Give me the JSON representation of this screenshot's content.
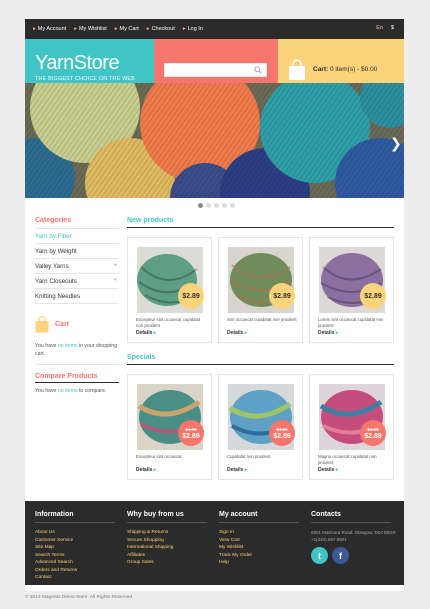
{
  "topbar": {
    "links": [
      "My Account",
      "My Wishlist",
      "My Cart",
      "Checkout",
      "Log In"
    ],
    "lang": "En",
    "currency": "$"
  },
  "logo": {
    "name": "YarnStore",
    "tagline": "THE BIGGEST CHOICE ON THE WEB"
  },
  "search": {
    "placeholder": ""
  },
  "cart": {
    "label": "Cart:",
    "summary": "0 item(s) - $0.00"
  },
  "banner": {
    "arrow": "❯"
  },
  "sidebar": {
    "categories_title": "Categories",
    "categories": [
      {
        "label": "Yarn by Fiber",
        "selected": true,
        "plus": false
      },
      {
        "label": "Yarn by Weight",
        "selected": false,
        "plus": false
      },
      {
        "label": "Valley Yarns",
        "selected": false,
        "plus": true
      },
      {
        "label": "Yarn Closeouts",
        "selected": false,
        "plus": true
      },
      {
        "label": "Knitting Needles",
        "selected": false,
        "plus": false
      }
    ],
    "cart_title": "Cart",
    "cart_text_1": "You have ",
    "cart_text_link": "no items",
    "cart_text_2": " in your shopping cart.",
    "compare_title": "Compare Products",
    "compare_text_1": "You have ",
    "compare_text_link": "no items",
    "compare_text_2": " to compare."
  },
  "new_products": {
    "title": "New products",
    "items": [
      {
        "price": "$2.89",
        "desc": "Excepteur sint occaecat cupidatat non proident",
        "details": "Details",
        "color": "#5e9e84"
      },
      {
        "price": "$2.89",
        "desc": "Sint occaecat cupidatat non proident",
        "details": "Details",
        "color": "#6f8c5a"
      },
      {
        "price": "$2.89",
        "desc": "Lorem sint occaecat cupidatat non proident",
        "details": "Details",
        "color": "#8a6fa0"
      }
    ]
  },
  "specials": {
    "title": "Specials",
    "items": [
      {
        "old": "$4.89",
        "price": "$2.89",
        "desc": "Excepteur sint occaecat",
        "details": "Details",
        "color": "#4a8f86"
      },
      {
        "old": "$4.89",
        "price": "$2.89",
        "desc": "Cupidatat non proident",
        "details": "Details",
        "color": "#5ea1c4"
      },
      {
        "old": "$4.89",
        "price": "$2.89",
        "desc": "Magna occaecat cupidatat non proident",
        "details": "Details",
        "color": "#c54d7c"
      }
    ]
  },
  "footer": {
    "info_title": "Information",
    "info_links": [
      "About Us",
      "Customer Service",
      "Site Map",
      "Search Terms",
      "Advanced Search",
      "Orders and Returns",
      "Contact"
    ],
    "why_title": "Why buy from us",
    "why_links": [
      "Shipping & Returns",
      "Secure Shopping",
      "International Shipping",
      "Affiliates",
      "Group Sales"
    ],
    "account_title": "My account",
    "account_links": [
      "Sign In",
      "View Cart",
      "My Wishlist",
      "Track My Order",
      "Help"
    ],
    "contacts_title": "Contacts",
    "address": "8901 Marmora Road, Glasgow, D04 89GR",
    "phone": "+1(234) 567 8901"
  },
  "copyright": "© 2013 Magento Demo Store. All Rights Reserved.",
  "colors": {
    "teal": "#40c4c6",
    "coral": "#f5766c",
    "yellow": "#fbd37a",
    "dark": "#2b2b2b"
  }
}
